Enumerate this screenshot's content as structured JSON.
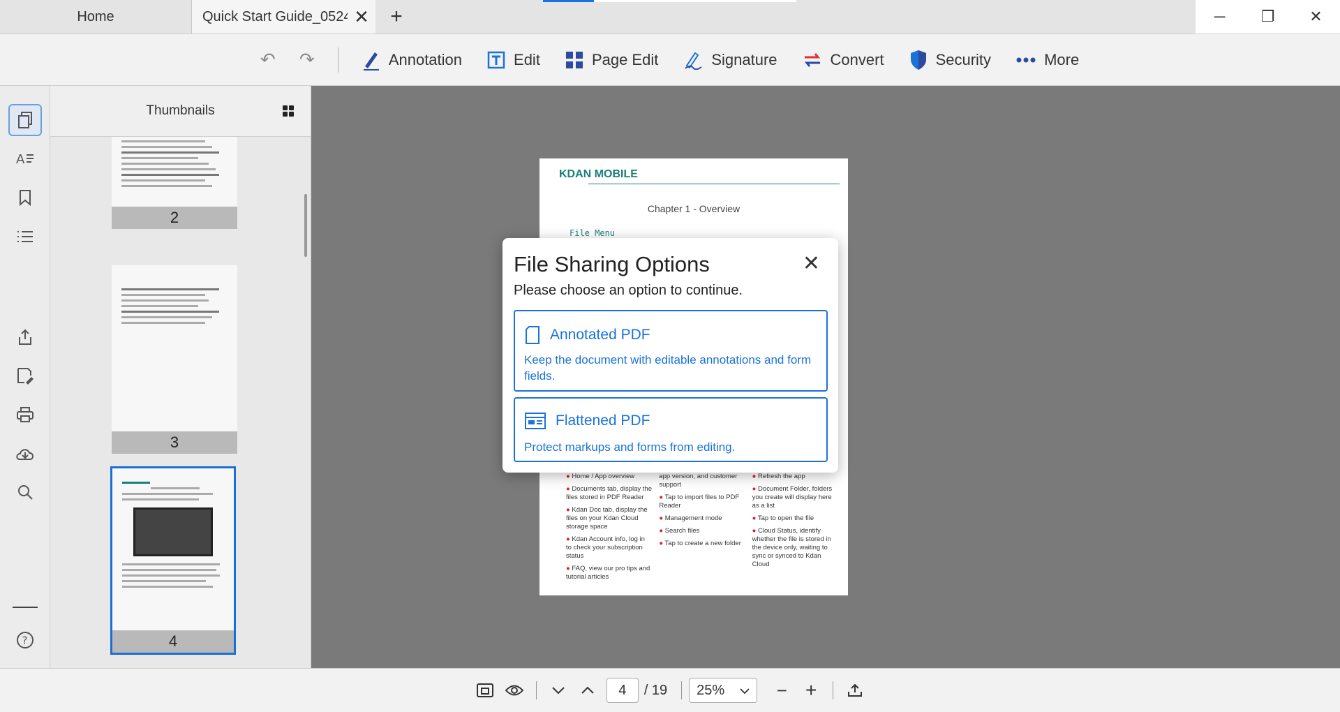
{
  "tabs": {
    "home": "Home",
    "active": "Quick Start Guide_0524....",
    "add": "+",
    "close": "✕"
  },
  "window_controls": {
    "minimize": "─",
    "restore": "❐",
    "close": "✕"
  },
  "toolbar": {
    "undo": "↶",
    "redo": "↷",
    "annotation": "Annotation",
    "edit": "Edit",
    "page_edit": "Page Edit",
    "signature": "Signature",
    "convert": "Convert",
    "security": "Security",
    "more": "More"
  },
  "thumbnails": {
    "title": "Thumbnails",
    "pages": [
      "2",
      "3",
      "4"
    ],
    "selected_page": "4"
  },
  "document": {
    "logo": "KDAN MOBILE",
    "chapter": "Chapter 1 - Overview",
    "file_menu": "File Menu",
    "col1": [
      "Home / App overview",
      "Documents tab, display the files stored in PDF Reader",
      "Kdan Doc tab, display the files on your Kdan Cloud storage space",
      "Kdan Account info, log in to check your subscription status",
      "FAQ, view our pro tips and tutorial articles"
    ],
    "col2": [
      "app version, and customer support",
      "Tap to import files to PDF Reader",
      "Management mode",
      "Search files",
      "Tap to create a new folder"
    ],
    "col3": [
      "Refresh the app",
      "Document Folder, folders you create will display here as a list",
      "Tap to open the file",
      "Cloud Status, identify whether the file is stored in the device only, waiting to sync or synced to Kdan Cloud"
    ]
  },
  "dialog": {
    "title": "File Sharing Options",
    "subtitle": "Please choose an option to continue.",
    "close": "✕",
    "options": [
      {
        "label": "Annotated PDF",
        "description": "Keep the document with editable annotations and form fields."
      },
      {
        "label": "Flattened PDF",
        "description": "Protect markups and forms from editing."
      }
    ]
  },
  "bottombar": {
    "current_page": "4",
    "total_pages": "/ 19",
    "zoom": "25%",
    "zoom_out": "−",
    "zoom_in": "+"
  },
  "colors": {
    "accent": "#1a73d9",
    "brand_teal": "#1a7f7a",
    "convert_red": "#e03030"
  }
}
